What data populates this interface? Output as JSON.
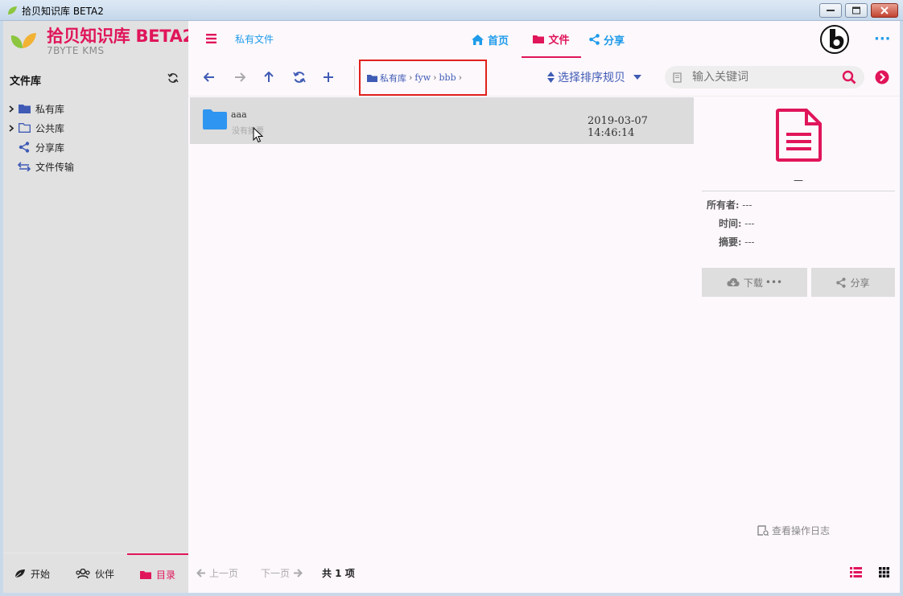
{
  "window": {
    "title": "拾贝知识库 BETA2"
  },
  "sidebar": {
    "app_name": "拾贝知识库 BETA2",
    "app_sub": "7BYTE KMS",
    "library_title": "文件库",
    "tree": [
      {
        "label": "私有库",
        "icon": "folder-solid-icon",
        "expandable": true
      },
      {
        "label": "公共库",
        "icon": "folder-outline-icon",
        "expandable": true
      },
      {
        "label": "分享库",
        "icon": "share-icon",
        "expandable": false
      },
      {
        "label": "文件传输",
        "icon": "transfer-icon",
        "expandable": false
      }
    ],
    "bottom_tabs": [
      {
        "label": "开始",
        "icon": "leaf-icon"
      },
      {
        "label": "伙伴",
        "icon": "users-icon"
      },
      {
        "label": "目录",
        "icon": "folder-icon",
        "active": true
      }
    ]
  },
  "topnav": {
    "private_link": "私有文件",
    "tabs": [
      {
        "label": "首页",
        "icon": "home-icon"
      },
      {
        "label": "文件",
        "icon": "folder-icon",
        "active": true
      },
      {
        "label": "分享",
        "icon": "share-icon"
      }
    ],
    "more": "···"
  },
  "toolbar": {
    "breadcrumb": [
      "私有库",
      "fyw",
      "bbb"
    ],
    "breadcrumb_sep": "›",
    "sort_label": "选择排序规贝",
    "search_placeholder": "输入关键词"
  },
  "files": [
    {
      "name": "aaa",
      "description": "没有摘要",
      "date": "2019-03-07 14:46:14",
      "type": "folder"
    }
  ],
  "detail": {
    "name": "—",
    "owner_label": "所有者:",
    "owner_value": "---",
    "time_label": "时间:",
    "time_value": "---",
    "summary_label": "摘要:",
    "summary_value": "---",
    "download_label": "下载",
    "download_more": "•••",
    "share_label": "分享",
    "oplog_label": "查看操作日志"
  },
  "pagination": {
    "prev_label": "上一页",
    "next_label": "下一页",
    "total_label": "共 1 项"
  },
  "colors": {
    "accent": "#e0155a",
    "link": "#1e9be9",
    "indigo": "#3f5bb5",
    "folder": "#2e95f0"
  }
}
